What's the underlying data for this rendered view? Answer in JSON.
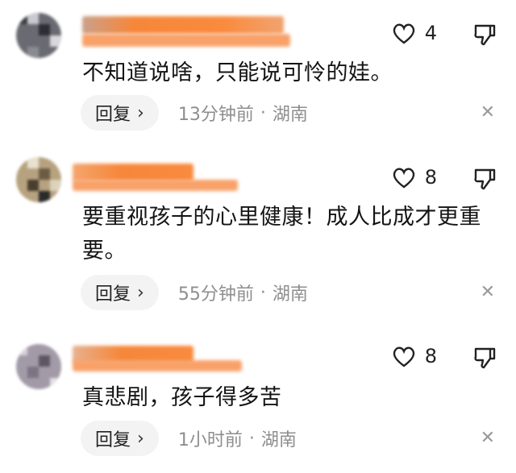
{
  "colors": {
    "accent_blur": "#f77f34",
    "reply_bg": "#f3f3f3",
    "meta_text": "#8e8e8e"
  },
  "comments": [
    {
      "likes": "4",
      "text": "不知道说啥，只能说可怜的娃。",
      "reply_label": "回复",
      "time": "13分钟前",
      "separator": "·",
      "location": "湖南"
    },
    {
      "likes": "8",
      "text": "要重视孩子的心里健康！成人比成才更重要。",
      "reply_label": "回复",
      "time": "55分钟前",
      "separator": "·",
      "location": "湖南"
    },
    {
      "likes": "8",
      "text": "真悲剧，孩子得多苦",
      "reply_label": "回复",
      "time": "1小时前",
      "separator": "·",
      "location": "湖南"
    }
  ],
  "icons": {
    "like": "heart-outline-icon",
    "dislike": "thumbs-down-icon",
    "close": "close-icon",
    "reply": "chevron-right-icon"
  }
}
